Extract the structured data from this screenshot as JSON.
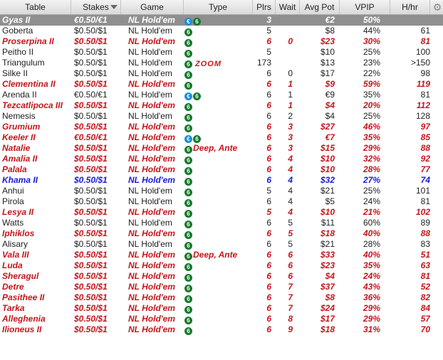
{
  "header": {
    "table": "Table",
    "stakes": "Stakes",
    "game": "Game",
    "type": "Type",
    "plrs": "Plrs",
    "wait": "Wait",
    "avg_pot": "Avg Pot",
    "vpip": "VPIP",
    "hhr": "H/hr"
  },
  "rows": [
    {
      "table": "Gyas II",
      "stakes": "€0.50/€1",
      "game": "NL Hold'em",
      "badges": [
        "euro",
        "six"
      ],
      "type_text": "",
      "zoom": "",
      "plrs": "3",
      "wait": "",
      "avg_pot": "€2",
      "vpip": "50%",
      "hhr": "",
      "style": "selected"
    },
    {
      "table": "Goberta",
      "stakes": "$0.50/$1",
      "game": "NL Hold'em",
      "badges": [
        "six"
      ],
      "type_text": "",
      "zoom": "",
      "plrs": "5",
      "wait": "",
      "avg_pot": "$8",
      "vpip": "44%",
      "hhr": "61",
      "style": "plain"
    },
    {
      "table": "Proserpina II",
      "stakes": "$0.50/$1",
      "game": "NL Hold'em",
      "badges": [
        "six"
      ],
      "type_text": "",
      "zoom": "",
      "plrs": "6",
      "wait": "0",
      "avg_pot": "$23",
      "vpip": "30%",
      "hhr": "81",
      "style": "red"
    },
    {
      "table": "Peitho II",
      "stakes": "$0.50/$1",
      "game": "NL Hold'em",
      "badges": [
        "six"
      ],
      "type_text": "",
      "zoom": "",
      "plrs": "5",
      "wait": "",
      "avg_pot": "$10",
      "vpip": "25%",
      "hhr": "100",
      "style": "plain"
    },
    {
      "table": "Triangulum",
      "stakes": "$0.50/$1",
      "game": "NL Hold'em",
      "badges": [
        "six"
      ],
      "type_text": "",
      "zoom": "ZOOM",
      "plrs": "173",
      "wait": "",
      "avg_pot": "$13",
      "vpip": "23%",
      "hhr": ">150",
      "style": "plain"
    },
    {
      "table": "Silke II",
      "stakes": "$0.50/$1",
      "game": "NL Hold'em",
      "badges": [
        "six"
      ],
      "type_text": "",
      "zoom": "",
      "plrs": "6",
      "wait": "0",
      "avg_pot": "$17",
      "vpip": "22%",
      "hhr": "98",
      "style": "plain"
    },
    {
      "table": "Clementina II",
      "stakes": "$0.50/$1",
      "game": "NL Hold'em",
      "badges": [
        "six"
      ],
      "type_text": "",
      "zoom": "",
      "plrs": "6",
      "wait": "1",
      "avg_pot": "$9",
      "vpip": "59%",
      "hhr": "119",
      "style": "red"
    },
    {
      "table": "Arenda II",
      "stakes": "€0.50/€1",
      "game": "NL Hold'em",
      "badges": [
        "euro",
        "six"
      ],
      "type_text": "",
      "zoom": "",
      "plrs": "6",
      "wait": "1",
      "avg_pot": "€9",
      "vpip": "35%",
      "hhr": "81",
      "style": "plain"
    },
    {
      "table": "Tezcatlipoca III",
      "stakes": "$0.50/$1",
      "game": "NL Hold'em",
      "badges": [
        "six"
      ],
      "type_text": "",
      "zoom": "",
      "plrs": "6",
      "wait": "1",
      "avg_pot": "$4",
      "vpip": "20%",
      "hhr": "112",
      "style": "red"
    },
    {
      "table": "Nemesis",
      "stakes": "$0.50/$1",
      "game": "NL Hold'em",
      "badges": [
        "six"
      ],
      "type_text": "",
      "zoom": "",
      "plrs": "6",
      "wait": "2",
      "avg_pot": "$4",
      "vpip": "25%",
      "hhr": "128",
      "style": "plain"
    },
    {
      "table": "Grumium",
      "stakes": "$0.50/$1",
      "game": "NL Hold'em",
      "badges": [
        "six"
      ],
      "type_text": "",
      "zoom": "",
      "plrs": "6",
      "wait": "3",
      "avg_pot": "$27",
      "vpip": "46%",
      "hhr": "97",
      "style": "red"
    },
    {
      "table": "Keeler II",
      "stakes": "€0.50/€1",
      "game": "NL Hold'em",
      "badges": [
        "euro",
        "six"
      ],
      "type_text": "",
      "zoom": "",
      "plrs": "6",
      "wait": "3",
      "avg_pot": "€7",
      "vpip": "35%",
      "hhr": "85",
      "style": "red"
    },
    {
      "table": "Natalie",
      "stakes": "$0.50/$1",
      "game": "NL Hold'em",
      "badges": [
        "six"
      ],
      "type_text": "Deep, Ante",
      "zoom": "",
      "plrs": "6",
      "wait": "3",
      "avg_pot": "$15",
      "vpip": "29%",
      "hhr": "88",
      "style": "red"
    },
    {
      "table": "Amalia II",
      "stakes": "$0.50/$1",
      "game": "NL Hold'em",
      "badges": [
        "six"
      ],
      "type_text": "",
      "zoom": "",
      "plrs": "6",
      "wait": "4",
      "avg_pot": "$10",
      "vpip": "32%",
      "hhr": "92",
      "style": "red"
    },
    {
      "table": "Palala",
      "stakes": "$0.50/$1",
      "game": "NL Hold'em",
      "badges": [
        "six"
      ],
      "type_text": "",
      "zoom": "",
      "plrs": "6",
      "wait": "4",
      "avg_pot": "$10",
      "vpip": "28%",
      "hhr": "77",
      "style": "red"
    },
    {
      "table": "Khama II",
      "stakes": "$0.50/$1",
      "game": "NL Hold'em",
      "badges": [
        "six"
      ],
      "type_text": "",
      "zoom": "",
      "plrs": "6",
      "wait": "4",
      "avg_pot": "$32",
      "vpip": "27%",
      "hhr": "74",
      "style": "blue"
    },
    {
      "table": "Anhui",
      "stakes": "$0.50/$1",
      "game": "NL Hold'em",
      "badges": [
        "six"
      ],
      "type_text": "",
      "zoom": "",
      "plrs": "5",
      "wait": "4",
      "avg_pot": "$21",
      "vpip": "25%",
      "hhr": "101",
      "style": "plain"
    },
    {
      "table": "Pirola",
      "stakes": "$0.50/$1",
      "game": "NL Hold'em",
      "badges": [
        "six"
      ],
      "type_text": "",
      "zoom": "",
      "plrs": "6",
      "wait": "4",
      "avg_pot": "$5",
      "vpip": "24%",
      "hhr": "81",
      "style": "plain"
    },
    {
      "table": "Lesya II",
      "stakes": "$0.50/$1",
      "game": "NL Hold'em",
      "badges": [
        "six"
      ],
      "type_text": "",
      "zoom": "",
      "plrs": "5",
      "wait": "4",
      "avg_pot": "$10",
      "vpip": "21%",
      "hhr": "102",
      "style": "red"
    },
    {
      "table": "Watts",
      "stakes": "$0.50/$1",
      "game": "NL Hold'em",
      "badges": [
        "six"
      ],
      "type_text": "",
      "zoom": "",
      "plrs": "6",
      "wait": "5",
      "avg_pot": "$11",
      "vpip": "60%",
      "hhr": "89",
      "style": "plain"
    },
    {
      "table": "Iphiklos",
      "stakes": "$0.50/$1",
      "game": "NL Hold'em",
      "badges": [
        "six"
      ],
      "type_text": "",
      "zoom": "",
      "plrs": "6",
      "wait": "5",
      "avg_pot": "$18",
      "vpip": "40%",
      "hhr": "88",
      "style": "red"
    },
    {
      "table": "Alisary",
      "stakes": "$0.50/$1",
      "game": "NL Hold'em",
      "badges": [
        "six"
      ],
      "type_text": "",
      "zoom": "",
      "plrs": "6",
      "wait": "5",
      "avg_pot": "$21",
      "vpip": "28%",
      "hhr": "83",
      "style": "plain"
    },
    {
      "table": "Vala III",
      "stakes": "$0.50/$1",
      "game": "NL Hold'em",
      "badges": [
        "six"
      ],
      "type_text": "Deep, Ante",
      "zoom": "",
      "plrs": "6",
      "wait": "6",
      "avg_pot": "$33",
      "vpip": "40%",
      "hhr": "51",
      "style": "red"
    },
    {
      "table": "Luda",
      "stakes": "$0.50/$1",
      "game": "NL Hold'em",
      "badges": [
        "six"
      ],
      "type_text": "",
      "zoom": "",
      "plrs": "6",
      "wait": "6",
      "avg_pot": "$23",
      "vpip": "35%",
      "hhr": "63",
      "style": "red"
    },
    {
      "table": "Sheragul",
      "stakes": "$0.50/$1",
      "game": "NL Hold'em",
      "badges": [
        "six"
      ],
      "type_text": "",
      "zoom": "",
      "plrs": "6",
      "wait": "6",
      "avg_pot": "$4",
      "vpip": "24%",
      "hhr": "81",
      "style": "red"
    },
    {
      "table": "Detre",
      "stakes": "$0.50/$1",
      "game": "NL Hold'em",
      "badges": [
        "six"
      ],
      "type_text": "",
      "zoom": "",
      "plrs": "6",
      "wait": "7",
      "avg_pot": "$37",
      "vpip": "43%",
      "hhr": "52",
      "style": "red"
    },
    {
      "table": "Pasithee II",
      "stakes": "$0.50/$1",
      "game": "NL Hold'em",
      "badges": [
        "six"
      ],
      "type_text": "",
      "zoom": "",
      "plrs": "6",
      "wait": "7",
      "avg_pot": "$8",
      "vpip": "36%",
      "hhr": "82",
      "style": "red"
    },
    {
      "table": "Tarka",
      "stakes": "$0.50/$1",
      "game": "NL Hold'em",
      "badges": [
        "six"
      ],
      "type_text": "",
      "zoom": "",
      "plrs": "6",
      "wait": "7",
      "avg_pot": "$24",
      "vpip": "29%",
      "hhr": "84",
      "style": "red"
    },
    {
      "table": "Alleghenia",
      "stakes": "$0.50/$1",
      "game": "NL Hold'em",
      "badges": [
        "six"
      ],
      "type_text": "",
      "zoom": "",
      "plrs": "6",
      "wait": "8",
      "avg_pot": "$17",
      "vpip": "29%",
      "hhr": "57",
      "style": "red"
    },
    {
      "table": "Ilioneus II",
      "stakes": "$0.50/$1",
      "game": "NL Hold'em",
      "badges": [
        "six"
      ],
      "type_text": "",
      "zoom": "",
      "plrs": "6",
      "wait": "9",
      "avg_pot": "$18",
      "vpip": "31%",
      "hhr": "70",
      "style": "red"
    }
  ],
  "icons": {
    "six": {
      "glyph": "6",
      "color": "#137a2c"
    },
    "euro": {
      "glyph": "€",
      "color": "#1b8fd4"
    },
    "gear": {
      "glyph": "⚙",
      "name": "gear-icon"
    }
  },
  "colors": {
    "selected_row_bg": "#8f8f8f",
    "highlight_red": "#c4161c",
    "highlight_blue": "#1a1adb",
    "zoom_red": "#d0131b"
  }
}
